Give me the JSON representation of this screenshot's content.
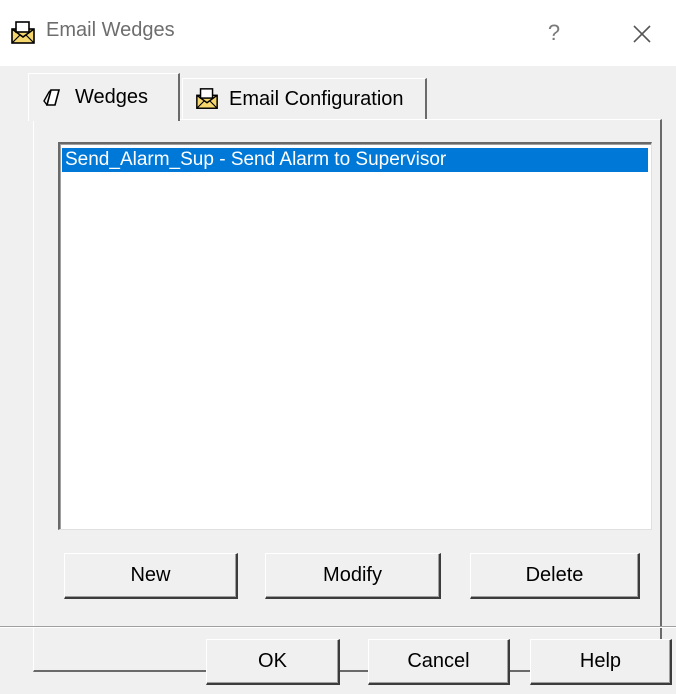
{
  "window": {
    "title": "Email Wedges",
    "help_label": "?",
    "icon": "email-envelope-icon"
  },
  "tabs": [
    {
      "label": "Wedges",
      "icon": "wedge-icon",
      "active": true
    },
    {
      "label": "Email Configuration",
      "icon": "email-envelope-icon",
      "active": false
    }
  ],
  "wedge_list": {
    "items": [
      {
        "text": "Send_Alarm_Sup - Send Alarm to Supervisor",
        "selected": true
      }
    ]
  },
  "list_buttons": {
    "new_label": "New",
    "modify_label": "Modify",
    "delete_label": "Delete"
  },
  "dialog_buttons": {
    "ok_label": "OK",
    "cancel_label": "Cancel",
    "help_label": "Help"
  },
  "colors": {
    "selection": "#0078d7",
    "dialog_bg": "#f0f0f0",
    "title_text": "#6d6d6d"
  }
}
